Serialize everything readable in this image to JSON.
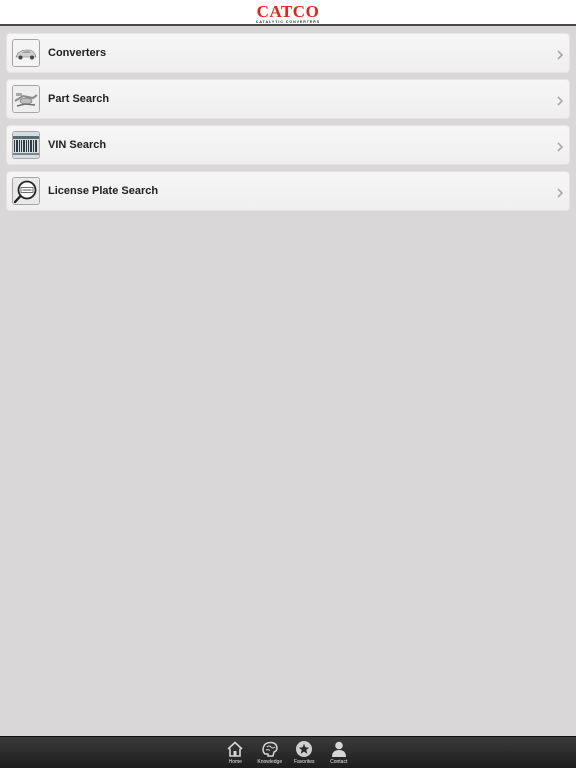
{
  "header": {
    "logo_text": "CATCO",
    "logo_subtitle": "CATALYTIC CONVERTERS"
  },
  "menu": {
    "items": [
      {
        "label": "Converters",
        "icon": "car-icon"
      },
      {
        "label": "Part Search",
        "icon": "exhaust-parts-icon"
      },
      {
        "label": "VIN Search",
        "icon": "barcode-icon"
      },
      {
        "label": "License Plate Search",
        "icon": "license-plate-magnifier-icon"
      }
    ]
  },
  "tabbar": {
    "tabs": [
      {
        "label": "Home",
        "icon": "home-icon"
      },
      {
        "label": "Knowledge",
        "icon": "brain-icon"
      },
      {
        "label": "Favorites",
        "icon": "star-icon"
      },
      {
        "label": "Contact",
        "icon": "person-icon"
      }
    ]
  },
  "colors": {
    "brand_red": "#e2231a",
    "background": "#d9d7d8",
    "tabbar": "#2a2a2a"
  }
}
